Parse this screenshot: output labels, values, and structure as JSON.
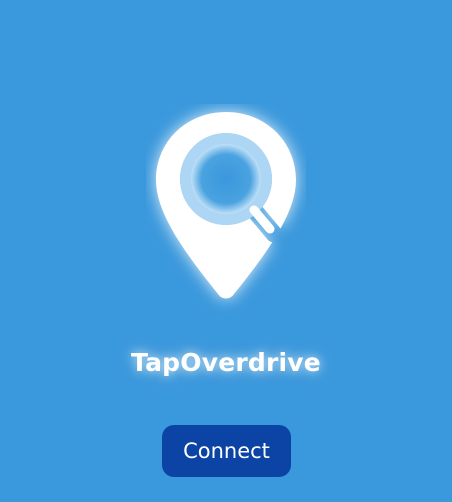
{
  "app": {
    "name": "TapOverdrive"
  },
  "actions": {
    "connect_label": "Connect"
  },
  "logo": {
    "icon": "location-pin-search-icon"
  },
  "colors": {
    "background": "#3a98dc",
    "button": "#0b44a4",
    "logo": "#ffffff",
    "text": "#ffffff"
  }
}
